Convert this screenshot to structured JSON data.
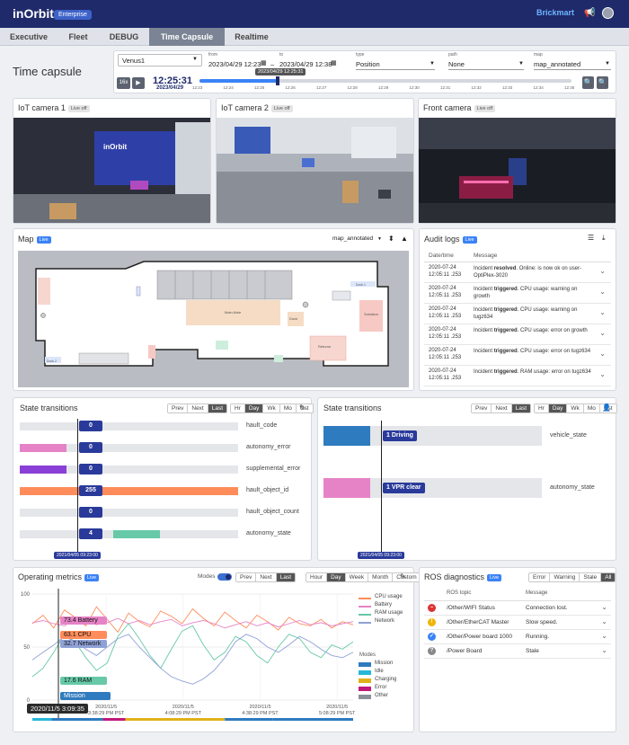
{
  "app": {
    "logo": "inOrbit",
    "edition": "Enterprise",
    "brand": "Brickmart"
  },
  "nav": [
    "Executive",
    "Fleet",
    "DEBUG",
    "Time Capsule",
    "Realtime"
  ],
  "page_title": "Time capsule",
  "controls": {
    "robot": "Venus1",
    "from_label": "from",
    "from": "2023/04/29 12:23",
    "to_label": "to",
    "to": "2023/04/29 12:38",
    "type_label": "type",
    "type": "Position",
    "path_label": "path",
    "path": "None",
    "map_label": "map",
    "map": "map_annotated",
    "speed": "16x",
    "clock": "12:25:31",
    "date": "2023/04/29",
    "timeline_tip": "2023/04/29 12:25:31",
    "ticks": [
      "12:23",
      "12:24",
      "12:25",
      "12:26",
      "12:27",
      "12:28",
      "12:29",
      "12:30",
      "12:31",
      "12:32",
      "12:33",
      "12:34",
      "12:35"
    ]
  },
  "cameras": [
    {
      "title": "IoT camera 1",
      "badge": "Live off"
    },
    {
      "title": "IoT camera 2",
      "badge": "Live off"
    },
    {
      "title": "Front camera",
      "badge": "Live off"
    }
  ],
  "map": {
    "title": "Map",
    "badge": "Live",
    "select": "map_annotated",
    "labels": [
      "Main Aisle",
      "Dock",
      "Sortation",
      "Returns",
      "Dock 1",
      "Dock 2"
    ]
  },
  "audit": {
    "title": "Audit logs",
    "badge": "Live",
    "col_date": "Date/time",
    "col_msg": "Message",
    "rows": [
      {
        "d": "2020-07-24",
        "t": "12:05:11 .253",
        "pre": "Incident ",
        "b": "resolved",
        "post": ". Online: is now ok on user-OptiPlex-3020"
      },
      {
        "d": "2020-07-24",
        "t": "12:05:11 .253",
        "pre": "Incident ",
        "b": "triggered",
        "post": ". CPU usage: warning on growth"
      },
      {
        "d": "2020-07-24",
        "t": "12:05:11 .253",
        "pre": "Incident ",
        "b": "triggered",
        "post": ". CPU usage: warning on tugz634"
      },
      {
        "d": "2020-07-24",
        "t": "12:05:11 .253",
        "pre": "Incident ",
        "b": "triggered",
        "post": ". CPU usage: error on growth"
      },
      {
        "d": "2020-07-24",
        "t": "12:05:11 .253",
        "pre": "Incident ",
        "b": "triggered",
        "post": ". CPU usage: error on tugz634"
      },
      {
        "d": "2020-07-24",
        "t": "12:05:11 .253",
        "pre": "Incident ",
        "b": "triggered",
        "post": ". RAM usage: error on tugz634"
      }
    ]
  },
  "state1": {
    "title": "State transitions",
    "nav": [
      "Prev",
      "Next",
      "Last"
    ],
    "ranges": [
      "Hr",
      "Day",
      "Wk",
      "Mo",
      "Cst"
    ],
    "cursor": "2021/04/05 09:23:00",
    "rows": [
      {
        "label": "hault_code",
        "value": "0",
        "color": ""
      },
      {
        "label": "autonomy_error",
        "value": "0",
        "color": "#e583c6"
      },
      {
        "label": "supplemental_error",
        "value": "0",
        "color": "#8a3fd6"
      },
      {
        "label": "hault_object_id",
        "value": "255",
        "color": "#ff8c5a"
      },
      {
        "label": "hault_object_count",
        "value": "0",
        "color": ""
      },
      {
        "label": "autonomy_state",
        "value": "4",
        "color": "#67c9a8"
      }
    ]
  },
  "state2": {
    "title": "State transitions",
    "nav": [
      "Prev",
      "Next",
      "Last"
    ],
    "ranges": [
      "Hr",
      "Day",
      "Wk",
      "Mo",
      "Cst"
    ],
    "cursor": "2021/04/05 09:23:00",
    "rows": [
      {
        "label": "vehicle_state",
        "value": "1 Driving",
        "color": "#2f7bbf"
      },
      {
        "label": "autonomy_state",
        "value": "1 VPR clear",
        "color": "#e583c6"
      }
    ]
  },
  "metrics": {
    "title": "Operating metrics",
    "badge": "Live",
    "modes_label": "Modes",
    "nav": [
      "Prev",
      "Next",
      "Last"
    ],
    "ranges": [
      "Hour",
      "Day",
      "Week",
      "Month",
      "Custom"
    ],
    "legend": [
      {
        "name": "CPU usage",
        "color": "#ff8c5a"
      },
      {
        "name": "Battery",
        "color": "#e583c6"
      },
      {
        "name": "RAM usage",
        "color": "#67c9a8"
      },
      {
        "name": "Network",
        "color": "#8fa1d6"
      }
    ],
    "modes": [
      {
        "name": "Mission",
        "color": "#2f7bbf"
      },
      {
        "name": "Idle",
        "color": "#26b8d6"
      },
      {
        "name": "Charging",
        "color": "#e0b21a"
      },
      {
        "name": "Error",
        "color": "#c0197a"
      },
      {
        "name": "Other",
        "color": "#8a8f99"
      }
    ],
    "tags": [
      {
        "text": "73.4 Battery",
        "color": "#e583c6"
      },
      {
        "text": "63.1 CPU",
        "color": "#ff8c5a"
      },
      {
        "text": "32.7 Network",
        "color": "#8fa1d6"
      },
      {
        "text": "17.6 RAM",
        "color": "#67c9a8"
      },
      {
        "text": "Mission",
        "color": "#2f7bbf"
      }
    ],
    "cursor": "2020/11/5 3:09:35"
  },
  "chart_data": {
    "type": "line",
    "ylim": [
      0,
      100
    ],
    "yticks": [
      "100",
      "50",
      "0"
    ],
    "xticks": [
      {
        "d": "2020/11/5",
        "t": "3:38:29 PM PST"
      },
      {
        "d": "2020/11/5",
        "t": "4:08:29 PM PST"
      },
      {
        "d": "2020/11/5",
        "t": "4:38:29 PM PST"
      },
      {
        "d": "2020/11/5",
        "t": "5:08:29 PM PST"
      }
    ],
    "series": [
      {
        "name": "CPU usage",
        "color": "#ff8c5a",
        "values": [
          72,
          80,
          68,
          85,
          78,
          70,
          88,
          76,
          64,
          82,
          74,
          69,
          84,
          79,
          72,
          86,
          77,
          70,
          83,
          75,
          68,
          80,
          74,
          66,
          78,
          72,
          70,
          76,
          68,
          74,
          71
        ]
      },
      {
        "name": "Battery",
        "color": "#e583c6",
        "values": [
          73,
          75,
          72,
          70,
          76,
          74,
          71,
          73,
          77,
          72,
          75,
          71,
          74,
          76,
          70,
          73,
          75,
          72,
          68,
          71,
          74,
          70,
          73,
          69,
          72,
          75,
          71,
          73,
          70,
          72,
          74
        ]
      },
      {
        "name": "RAM usage",
        "color": "#67c9a8",
        "values": [
          22,
          30,
          45,
          62,
          55,
          40,
          28,
          35,
          60,
          72,
          58,
          42,
          30,
          48,
          65,
          70,
          52,
          38,
          45,
          60,
          55,
          42,
          35,
          50,
          62,
          58,
          45,
          40,
          52,
          48,
          55
        ]
      },
      {
        "name": "Network",
        "color": "#8fa1d6",
        "values": [
          38,
          45,
          52,
          60,
          55,
          48,
          42,
          50,
          58,
          62,
          50,
          40,
          30,
          22,
          18,
          15,
          20,
          28,
          40,
          55,
          62,
          58,
          50,
          45,
          52,
          60,
          55,
          48,
          42,
          40,
          45
        ]
      }
    ]
  },
  "ros": {
    "title": "ROS diagnostics",
    "badge": "Live",
    "filters": [
      "Error",
      "Warning",
      "Stale",
      "All"
    ],
    "col_topic": "ROS topic",
    "col_msg": "Message",
    "rows": [
      {
        "topic": "/Other/WIFI Status",
        "msg": "Connection lost.",
        "color": "#d33",
        "glyph": "–"
      },
      {
        "topic": "/Other/EtherCAT Master",
        "msg": "Slow speed.",
        "color": "#f1b400",
        "glyph": "!"
      },
      {
        "topic": "/Other/Power board 1000",
        "msg": "Running.",
        "color": "#3b82f6",
        "glyph": "✓"
      },
      {
        "topic": "/Power Board",
        "msg": "Stale",
        "color": "#888",
        "glyph": "?"
      }
    ]
  }
}
